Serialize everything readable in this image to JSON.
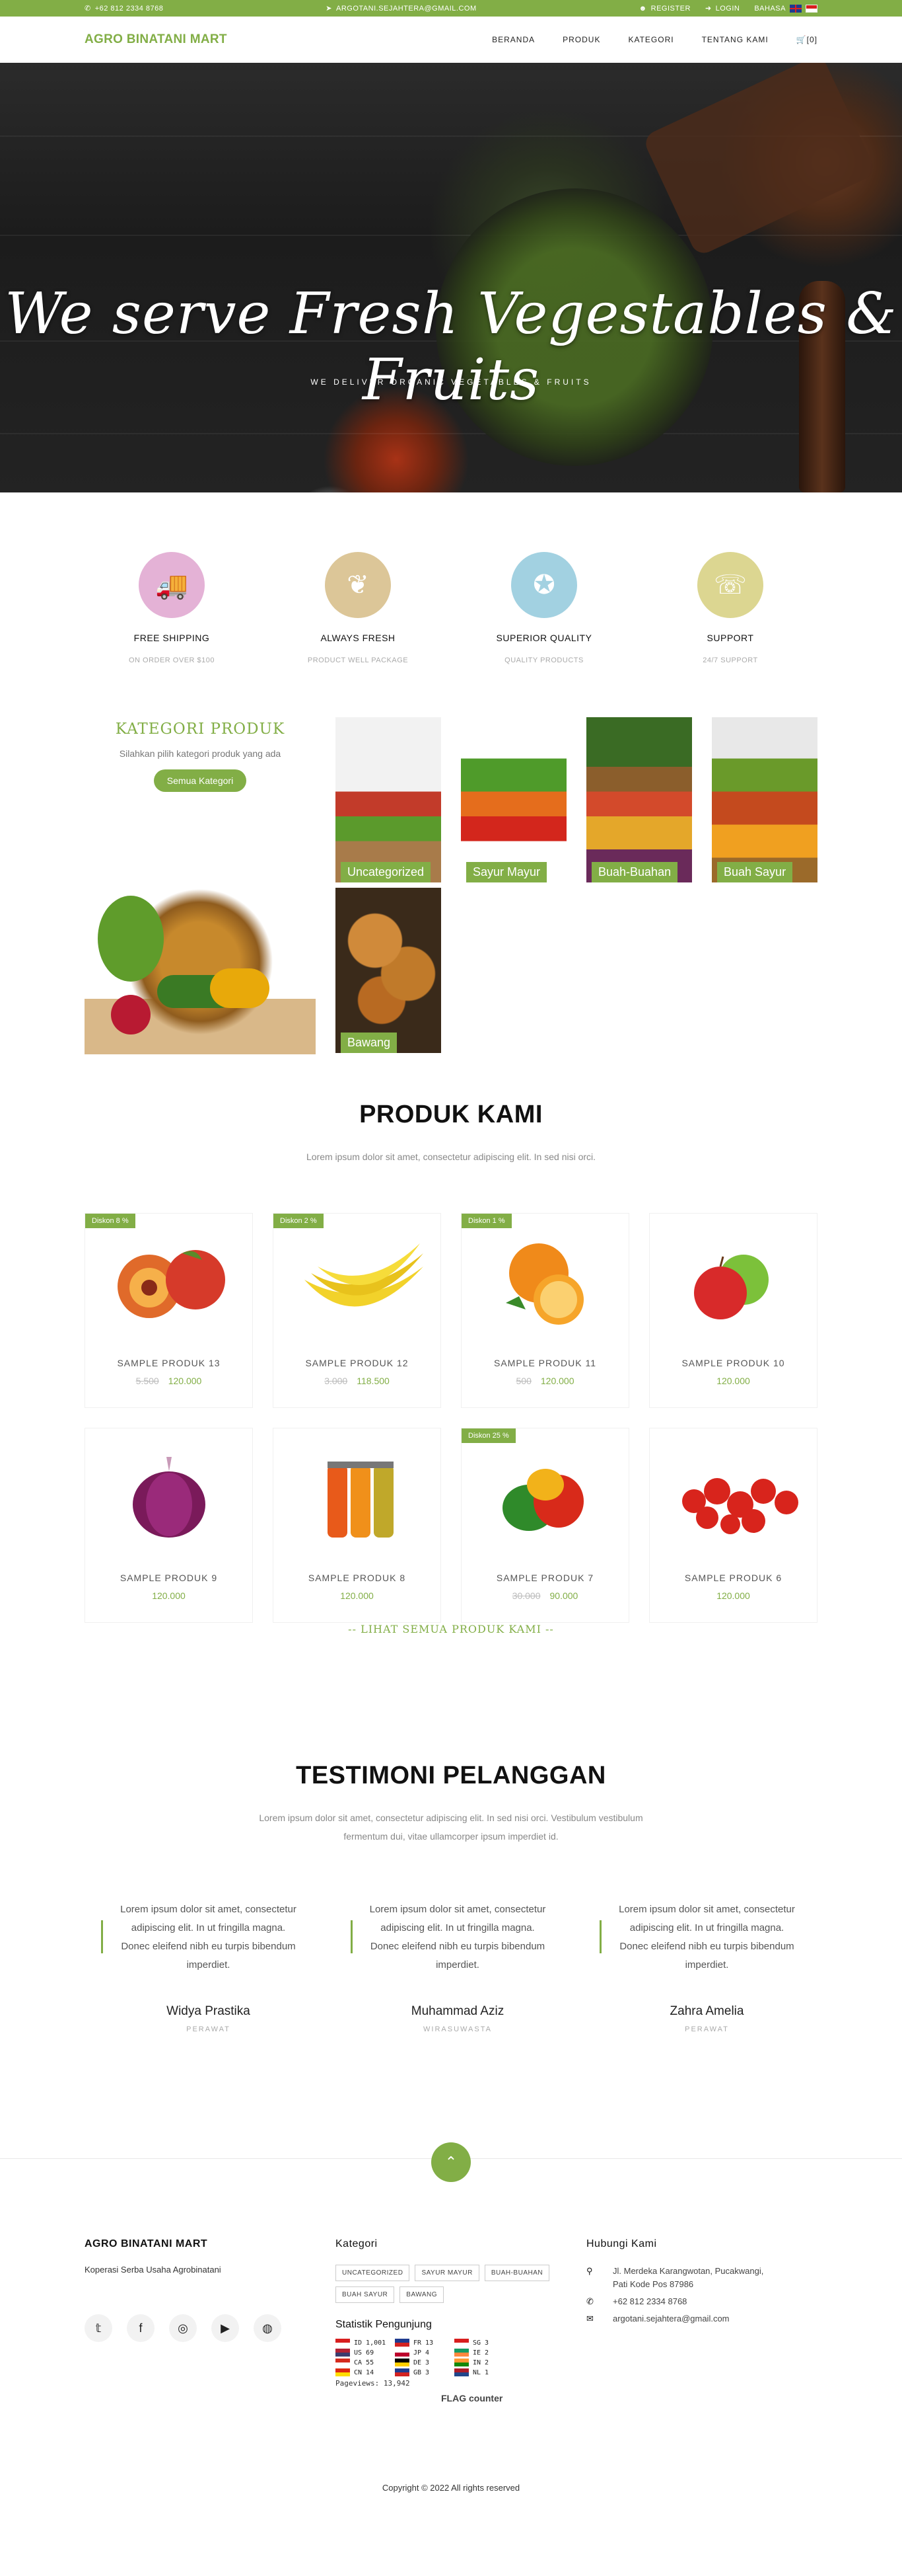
{
  "topbar": {
    "phone": "+62 812 2334 8768",
    "email": "ARGOTANI.SEJAHTERA@GMAIL.COM",
    "register": "REGISTER",
    "login": "LOGIN",
    "language": "BAHASA"
  },
  "nav": {
    "brand": "AGRO BINATANI MART",
    "items": [
      "BERANDA",
      "PRODUK",
      "KATEGORI",
      "TENTANG KAMI"
    ],
    "cart": "[0]"
  },
  "hero": {
    "title": "We serve Fresh Vegestables & Fruits",
    "subtitle": "WE DELIVER ORGANIC VEGETABLES & FRUITS"
  },
  "services": [
    {
      "title": "FREE SHIPPING",
      "subtitle": "ON ORDER OVER $100",
      "color": "#e4b2d6",
      "icon": "truck-icon"
    },
    {
      "title": "ALWAYS FRESH",
      "subtitle": "PRODUCT WELL PACKAGE",
      "color": "#dcc698",
      "icon": "leaf-icon"
    },
    {
      "title": "SUPERIOR QUALITY",
      "subtitle": "QUALITY PRODUCTS",
      "color": "#a2d1e1",
      "icon": "award-icon"
    },
    {
      "title": "SUPPORT",
      "subtitle": "24/7 SUPPORT",
      "color": "#dcd691",
      "icon": "headset-icon"
    }
  ],
  "category": {
    "title": "KATEGORI PRODUK",
    "desc": "Silahkan pilih kategori produk yang ada",
    "button": "Semua Kategori",
    "tiles": [
      "Uncategorized",
      "Sayur Mayur",
      "Buah-Buahan",
      "Buah Sayur",
      "Bawang"
    ]
  },
  "products": {
    "title": "PRODUK KAMI",
    "lead": "Lorem ipsum dolor sit amet, consectetur adipiscing elit. In sed nisi orci.",
    "items": [
      {
        "discount": "Diskon 8 %",
        "name": "SAMPLE PRODUK 13",
        "old": "5.500",
        "price": "120.000",
        "fruit": "peach"
      },
      {
        "discount": "Diskon 2 %",
        "name": "SAMPLE PRODUK 12",
        "old": "3.000",
        "price": "118.500",
        "fruit": "banana"
      },
      {
        "discount": "Diskon 1 %",
        "name": "SAMPLE PRODUK 11",
        "old": "500",
        "price": "120.000",
        "fruit": "orange"
      },
      {
        "discount": "",
        "name": "SAMPLE PRODUK 10",
        "old": "",
        "price": "120.000",
        "fruit": "apple"
      },
      {
        "discount": "",
        "name": "SAMPLE PRODUK 9",
        "old": "",
        "price": "120.000",
        "fruit": "onion"
      },
      {
        "discount": "",
        "name": "SAMPLE PRODUK 8",
        "old": "",
        "price": "120.000",
        "fruit": "juice"
      },
      {
        "discount": "Diskon 25 %",
        "name": "SAMPLE PRODUK 7",
        "old": "30.000",
        "price": "90.000",
        "fruit": "pepper"
      },
      {
        "discount": "",
        "name": "SAMPLE PRODUK 6",
        "old": "",
        "price": "120.000",
        "fruit": "strawberry"
      }
    ],
    "more": "-- LIHAT SEMUA PRODUK KAMI --"
  },
  "testimonials": {
    "title": "TESTIMONI PELANGGAN",
    "lead": "Lorem ipsum dolor sit amet, consectetur adipiscing elit. In sed nisi orci. Vestibulum vestibulum fermentum dui, vitae ullamcorper ipsum imperdiet id.",
    "items": [
      {
        "text": "Lorem ipsum dolor sit amet, consectetur adipiscing elit. In ut fringilla magna. Donec eleifend nibh eu turpis bibendum imperdiet.",
        "name": "Widya Prastika",
        "role": "PERAWAT"
      },
      {
        "text": "Lorem ipsum dolor sit amet, consectetur adipiscing elit. In ut fringilla magna. Donec eleifend nibh eu turpis bibendum imperdiet.",
        "name": "Muhammad Aziz",
        "role": "WIRASUWASTA"
      },
      {
        "text": "Lorem ipsum dolor sit amet, consectetur adipiscing elit. In ut fringilla magna. Donec eleifend nibh eu turpis bibendum imperdiet.",
        "name": "Zahra Amelia",
        "role": "PERAWAT"
      }
    ]
  },
  "footer": {
    "about_title": "AGRO BINATANI MART",
    "about_text": "Koperasi Serba Usaha Agrobinatani",
    "category_title": "Kategori",
    "tags": [
      "UNCATEGORIZED",
      "SAYUR MAYUR",
      "BUAH-BUAHAN",
      "BUAH SAYUR",
      "BAWANG"
    ],
    "stats_title": "Statistik Pengunjung",
    "counter": [
      {
        "cc": "ID",
        "n": "1,001",
        "c1": "#d81e1e",
        "c2": "#ffffff"
      },
      {
        "cc": "FR",
        "n": "13",
        "c1": "#1f3b8f",
        "c2": "#d22222"
      },
      {
        "cc": "SG",
        "n": "3",
        "c1": "#d81e1e",
        "c2": "#ffffff"
      },
      {
        "cc": "US",
        "n": "69",
        "c1": "#b22234",
        "c2": "#3c3b6e"
      },
      {
        "cc": "JP",
        "n": "4",
        "c1": "#ffffff",
        "c2": "#bc002d"
      },
      {
        "cc": "IE",
        "n": "2",
        "c1": "#169b62",
        "c2": "#ff883e"
      },
      {
        "cc": "CA",
        "n": "55",
        "c1": "#d52b1e",
        "c2": "#ffffff"
      },
      {
        "cc": "DE",
        "n": "3",
        "c1": "#000000",
        "c2": "#ffce00"
      },
      {
        "cc": "IN",
        "n": "2",
        "c1": "#ff9933",
        "c2": "#138808"
      },
      {
        "cc": "CN",
        "n": "14",
        "c1": "#de2910",
        "c2": "#ffde00"
      },
      {
        "cc": "GB",
        "n": "3",
        "c1": "#1f3b8f",
        "c2": "#d22222"
      },
      {
        "cc": "NL",
        "n": "1",
        "c1": "#ae1c28",
        "c2": "#21468b"
      }
    ],
    "pageviews": "Pageviews: 13,942",
    "flag_counter": "FLAG counter",
    "contact_title": "Hubungi Kami",
    "address": "Jl. Merdeka Karangwotan, Pucakwangi, Pati Kode Pos 87986",
    "phone": "+62 812 2334 8768",
    "email": "argotani.sejahtera@gmail.com",
    "copyright": "Copyright © 2022 All rights reserved"
  }
}
